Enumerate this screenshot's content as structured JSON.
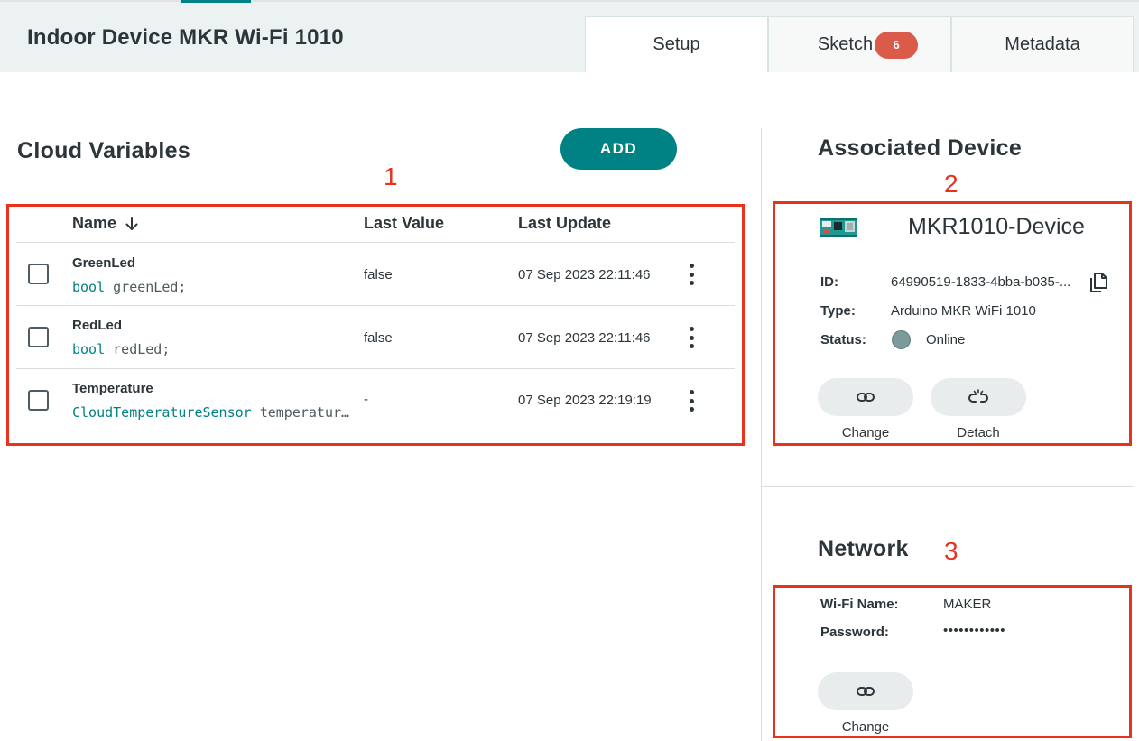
{
  "header": {
    "thing_title": "Indoor Device MKR Wi-Fi 1010",
    "tabs": {
      "setup": "Setup",
      "sketch": "Sketch",
      "sketch_badge": "6",
      "metadata": "Metadata"
    }
  },
  "cloud_variables": {
    "heading": "Cloud Variables",
    "add_label": "ADD",
    "marker": "1",
    "columns": {
      "name": "Name",
      "last_value": "Last Value",
      "last_update": "Last Update"
    },
    "rows": [
      {
        "name": "GreenLed",
        "type": "bool",
        "decl": "greenLed;",
        "last_value": "false",
        "last_update": "07 Sep 2023 22:11:46"
      },
      {
        "name": "RedLed",
        "type": "bool",
        "decl": "redLed;",
        "last_value": "false",
        "last_update": "07 Sep 2023 22:11:46"
      },
      {
        "name": "Temperature",
        "type": "CloudTemperatureSensor",
        "decl": "temperatur…",
        "last_value": "-",
        "last_update": "07 Sep 2023 22:19:19"
      }
    ]
  },
  "associated_device": {
    "heading": "Associated Device",
    "marker": "2",
    "device_name": "MKR1010-Device",
    "id_label": "ID:",
    "id_value": "64990519-1833-4bba-b035-...",
    "type_label": "Type:",
    "type_value": "Arduino MKR WiFi 1010",
    "status_label": "Status:",
    "status_value": "Online",
    "status_color": "#7c9a9c",
    "change_label": "Change",
    "detach_label": "Detach"
  },
  "network": {
    "heading": "Network",
    "marker": "3",
    "wifi_label": "Wi-Fi Name:",
    "wifi_value": "MAKER",
    "password_label": "Password:",
    "password_value": "••••••••••••",
    "change_label": "Change"
  },
  "colors": {
    "accent": "#008184",
    "annotation": "#e8331c",
    "badge": "#da5b4a"
  }
}
